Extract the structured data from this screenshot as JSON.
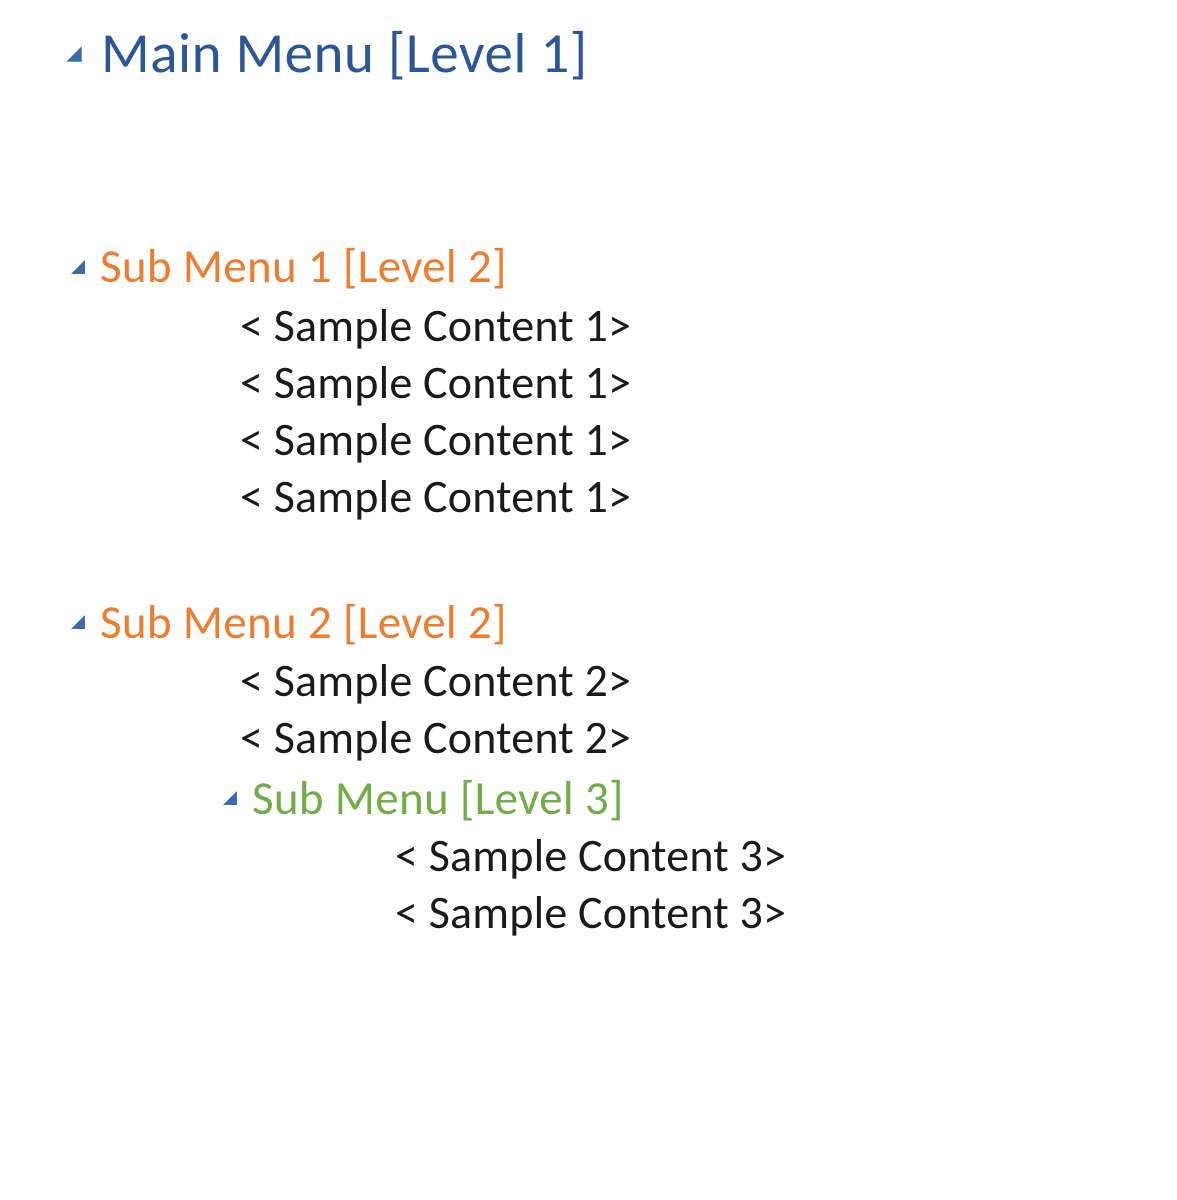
{
  "colors": {
    "level1": "#2b5797",
    "level2": "#ed7d31",
    "level3": "#70ad47",
    "body": "#1a1a1a",
    "triangle": "#3a6aa8"
  },
  "outline": {
    "level1": {
      "label": "Main Menu [Level 1]"
    },
    "sub1": {
      "label": "Sub Menu 1 [Level 2]",
      "content": [
        "< Sample Content 1>",
        "< Sample Content 1>",
        "< Sample Content 1>",
        "< Sample Content 1>"
      ]
    },
    "sub2": {
      "label": "Sub Menu 2 [Level 2]",
      "content": [
        "< Sample Content 2>",
        "< Sample Content 2>"
      ],
      "sub3": {
        "label": "Sub Menu [Level 3]",
        "content": [
          "< Sample Content 3>",
          "< Sample Content 3>"
        ]
      }
    }
  }
}
